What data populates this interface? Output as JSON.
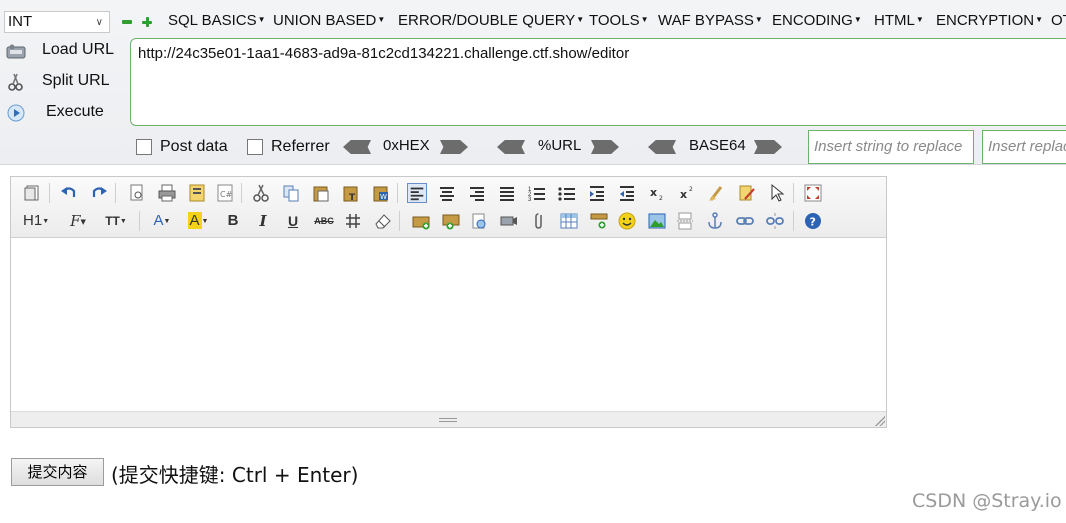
{
  "hackbar": {
    "type_select": "INT",
    "menu": [
      "SQL BASICS",
      "UNION BASED",
      "ERROR/DOUBLE QUERY",
      "TOOLS",
      "WAF BYPASS",
      "ENCODING",
      "HTML",
      "ENCRYPTION",
      "OT"
    ],
    "actions": [
      "Load URL",
      "Split URL",
      "Execute"
    ],
    "url": "http://24c35e01-1aa1-4683-ad9a-81c2cd134221.challenge.ctf.show/editor",
    "post_data_label": "Post data",
    "referrer_label": "Referrer",
    "encoders": [
      "0xHEX",
      "%URL",
      "BASE64"
    ],
    "replace_placeholder": "Insert string to replace",
    "replace_with_placeholder": "Insert replacing string"
  },
  "editor": {
    "toolbar_row2_labels": [
      "H1",
      "F",
      "TT",
      "A",
      "A",
      "B",
      "I",
      "U",
      "ABC"
    ]
  },
  "submit": {
    "button_label": "提交内容",
    "hint": "(提交快捷键: Ctrl + Enter)"
  },
  "watermark": "CSDN @Stray.io",
  "colors": {
    "hackbar_green_border": "#6db36d",
    "hackbar_bg": "#eceef1"
  }
}
